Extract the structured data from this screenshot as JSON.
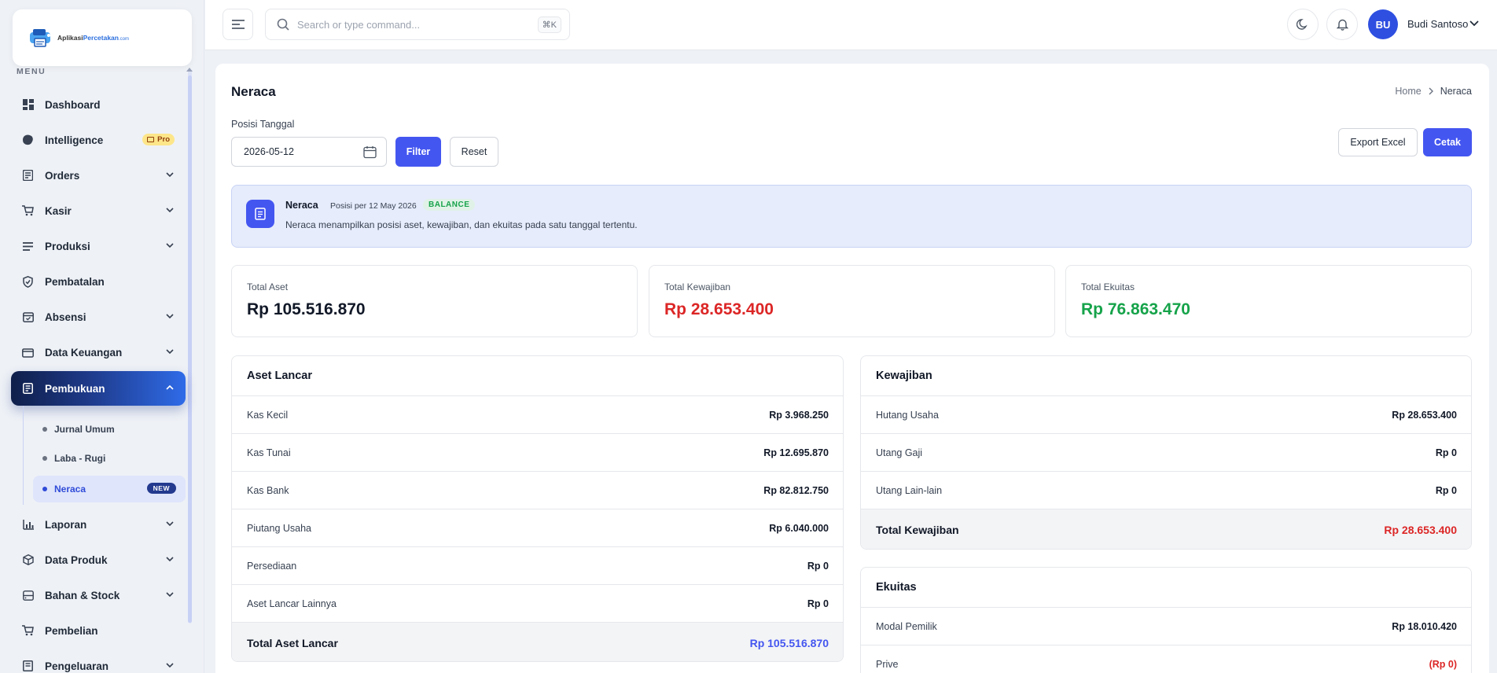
{
  "brand": {
    "logo_main": "Aplikasi",
    "logo_accent": "Percetakan",
    "logo_suffix": ".com"
  },
  "sidebar": {
    "menu_label": "MENU",
    "items": [
      {
        "label": "Dashboard",
        "icon": "dashboard-icon"
      },
      {
        "label": "Intelligence",
        "icon": "brain-icon",
        "badge": "Pro"
      },
      {
        "label": "Orders",
        "icon": "orders-icon"
      },
      {
        "label": "Kasir",
        "icon": "cart-icon"
      },
      {
        "label": "Produksi",
        "icon": "list-icon"
      },
      {
        "label": "Pembatalan",
        "icon": "shield-icon"
      },
      {
        "label": "Absensi",
        "icon": "calendar-check-icon"
      },
      {
        "label": "Data Keuangan",
        "icon": "wallet-icon"
      },
      {
        "label": "Pembukuan",
        "icon": "book-icon"
      },
      {
        "label": "Laporan",
        "icon": "chart-icon"
      },
      {
        "label": "Data Produk",
        "icon": "box-icon"
      },
      {
        "label": "Bahan & Stock",
        "icon": "database-icon"
      },
      {
        "label": "Pembelian",
        "icon": "cart-icon"
      },
      {
        "label": "Pengeluaran",
        "icon": "receipt-icon"
      }
    ],
    "sub_items": [
      {
        "label": "Jurnal Umum"
      },
      {
        "label": "Laba - Rugi"
      },
      {
        "label": "Neraca",
        "badge": "NEW"
      }
    ]
  },
  "topbar": {
    "search_placeholder": "Search or type command...",
    "shortcut": "⌘K",
    "user_initials": "BU",
    "user_name": "Budi Santoso"
  },
  "page": {
    "title": "Neraca",
    "breadcrumb_home": "Home",
    "breadcrumb_current": "Neraca",
    "date_label": "Posisi Tanggal",
    "date_value": "2026-05-12",
    "filter_label": "Filter",
    "reset_label": "Reset",
    "export_label": "Export Excel",
    "print_label": "Cetak"
  },
  "info": {
    "title": "Neraca",
    "date_text": "Posisi per 12 May 2026",
    "status": "BALANCE",
    "description": "Neraca menampilkan posisi aset, kewajiban, dan ekuitas pada satu tanggal tertentu."
  },
  "stats": [
    {
      "label": "Total Aset",
      "value": "Rp 105.516.870",
      "color": "#111827"
    },
    {
      "label": "Total Kewajiban",
      "value": "Rp 28.653.400",
      "color": "#dc2626"
    },
    {
      "label": "Total Ekuitas",
      "value": "Rp 76.863.470",
      "color": "#16a34a"
    }
  ],
  "aset_lancar": {
    "title": "Aset Lancar",
    "rows": [
      {
        "label": "Kas Kecil",
        "value": "Rp 3.968.250"
      },
      {
        "label": "Kas Tunai",
        "value": "Rp 12.695.870"
      },
      {
        "label": "Kas Bank",
        "value": "Rp 82.812.750"
      },
      {
        "label": "Piutang Usaha",
        "value": "Rp 6.040.000"
      },
      {
        "label": "Persediaan",
        "value": "Rp 0"
      },
      {
        "label": "Aset Lancar Lainnya",
        "value": "Rp 0"
      }
    ],
    "total_label": "Total Aset Lancar",
    "total_value": "Rp 105.516.870",
    "total_color": "#4456f0"
  },
  "kewajiban": {
    "title": "Kewajiban",
    "rows": [
      {
        "label": "Hutang Usaha",
        "value": "Rp 28.653.400"
      },
      {
        "label": "Utang Gaji",
        "value": "Rp 0"
      },
      {
        "label": "Utang Lain-lain",
        "value": "Rp 0"
      }
    ],
    "total_label": "Total Kewajiban",
    "total_value": "Rp 28.653.400",
    "total_color": "#dc2626"
  },
  "ekuitas": {
    "title": "Ekuitas",
    "rows": [
      {
        "label": "Modal Pemilik",
        "value": "Rp 18.010.420"
      },
      {
        "label": "Prive",
        "value": "(Rp 0)",
        "color": "#dc2626"
      }
    ]
  }
}
